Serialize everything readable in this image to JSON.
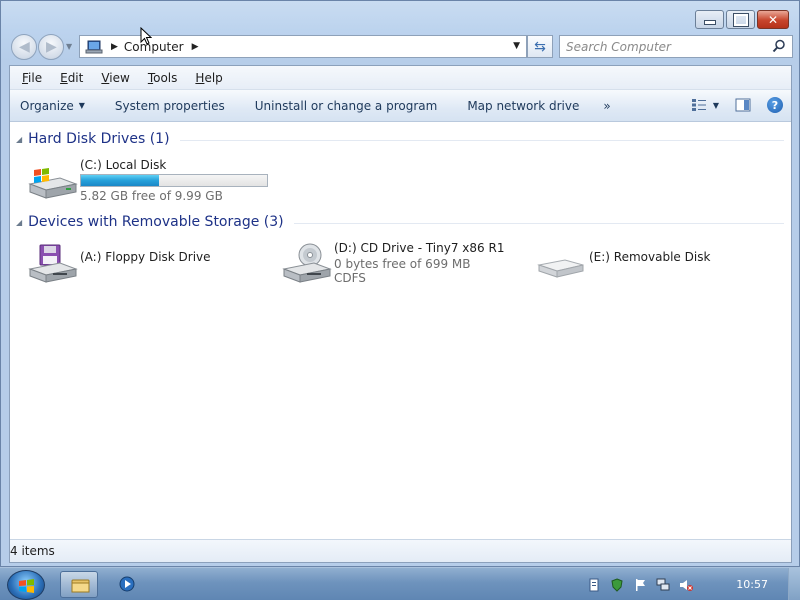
{
  "window": {
    "controls": {
      "minimize": "minimize",
      "maximize": "maximize",
      "close": "close"
    }
  },
  "address": {
    "icon": "computer-icon",
    "crumb": "Computer"
  },
  "search": {
    "placeholder": "Search Computer"
  },
  "menubar": {
    "items": [
      {
        "pre": "",
        "acc": "F",
        "post": "ile"
      },
      {
        "pre": "",
        "acc": "E",
        "post": "dit"
      },
      {
        "pre": "",
        "acc": "V",
        "post": "iew"
      },
      {
        "pre": "",
        "acc": "T",
        "post": "ools"
      },
      {
        "pre": "",
        "acc": "H",
        "post": "elp"
      }
    ]
  },
  "toolbar": {
    "organize": "Organize",
    "system_properties": "System properties",
    "uninstall": "Uninstall or change a program",
    "map_drive": "Map network drive",
    "more": "»"
  },
  "groups": {
    "hard_disks": "Hard Disk Drives (1)",
    "removable": "Devices with Removable Storage (3)"
  },
  "drives": {
    "c": {
      "name": "(C:) Local Disk",
      "space": "5.82 GB free of 9.99 GB",
      "used_fraction": 0.417
    },
    "a": {
      "name": "(A:) Floppy Disk Drive"
    },
    "d": {
      "name": "(D:) CD Drive - Tiny7 x86 R1",
      "space": "0 bytes free of 699 MB",
      "fs": "CDFS"
    },
    "e": {
      "name": "(E:) Removable Disk"
    }
  },
  "status": {
    "items": "4 items"
  },
  "taskbar": {
    "clock": "10:57"
  },
  "colors": {
    "group_title": "#1e3287",
    "link_text": "#1e395b",
    "bar_fill": "#26a0da"
  }
}
